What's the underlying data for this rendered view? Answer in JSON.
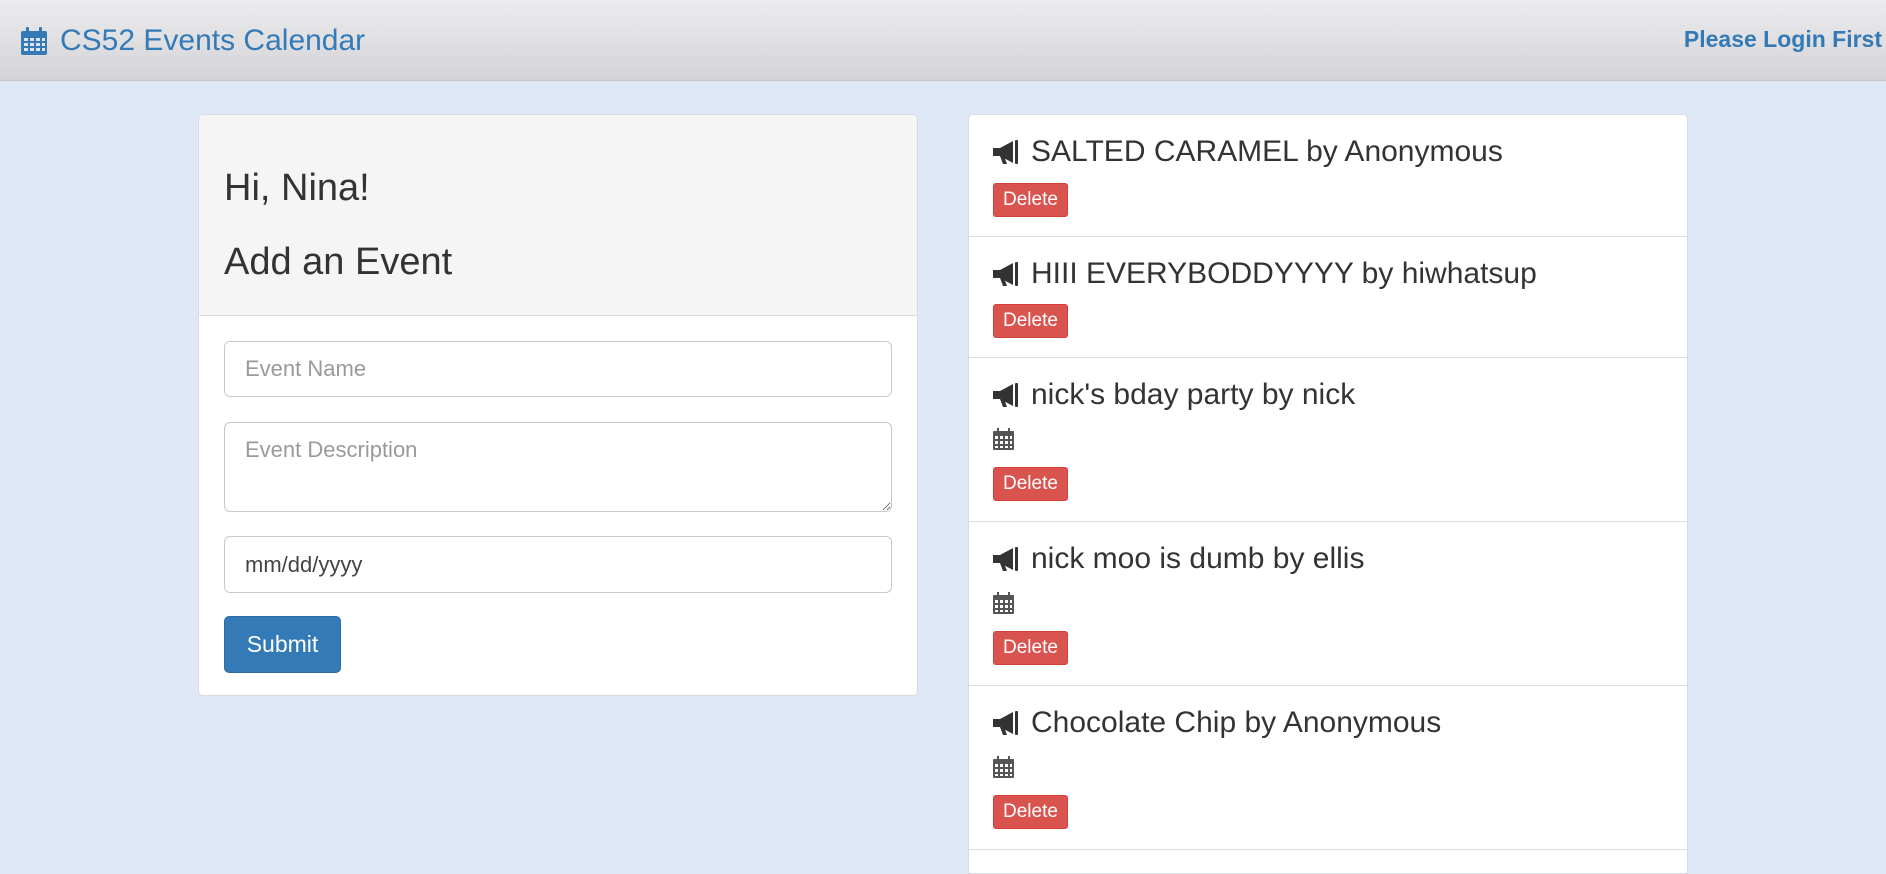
{
  "header": {
    "brand": "CS52 Events Calendar",
    "login_link": "Please Login First"
  },
  "form": {
    "greeting": "Hi, Nina!",
    "title": "Add an Event",
    "name_placeholder": "Event Name",
    "description_placeholder": "Event Description",
    "date_value": "mm/dd/yyyy",
    "submit_label": "Submit"
  },
  "events": [
    {
      "title": "SALTED CARAMEL by Anonymous",
      "delete_label": "Delete"
    },
    {
      "title": "HIII EVERYBODDYYYY by hiwhatsup",
      "delete_label": "Delete"
    },
    {
      "title": "nick's bday party by nick",
      "delete_label": "Delete"
    },
    {
      "title": "nick moo is dumb by ellis",
      "delete_label": "Delete"
    },
    {
      "title": "Chocolate Chip by Anonymous",
      "delete_label": "Delete"
    }
  ],
  "colors": {
    "page_background": "#dfe8f7",
    "link": "#337ab7",
    "primary_button": "#337ab7",
    "danger_button": "#d9534f",
    "panel_heading": "#f5f5f5"
  },
  "icons": {
    "brand": "calendar-icon",
    "event": "megaphone-icon",
    "event_date": "calendar-icon"
  }
}
